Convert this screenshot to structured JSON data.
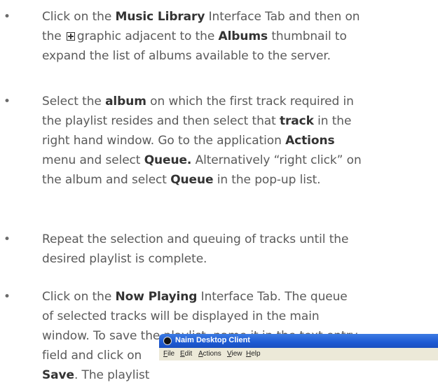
{
  "items": [
    {
      "bullet": "•",
      "lines": [
        [
          {
            "t": "Click on the "
          },
          {
            "t": "Music Library",
            "b": true
          },
          {
            "t": " Interface Tab and then on"
          }
        ],
        [
          {
            "t": "the "
          },
          {
            "icon": "expand"
          },
          {
            "t": "graphic adjacent to the "
          },
          {
            "t": "Albums",
            "b": true
          },
          {
            "t": " thumbnail to"
          }
        ],
        [
          {
            "t": "expand the list of albums available to the server."
          }
        ]
      ]
    },
    {
      "bullet": "•",
      "lines": [
        [
          {
            "t": "Select the "
          },
          {
            "t": "album",
            "b": true
          },
          {
            "t": " on which the first track required in"
          }
        ],
        [
          {
            "t": "the playlist resides and then select that "
          },
          {
            "t": "track",
            "b": true
          },
          {
            "t": " in the"
          }
        ],
        [
          {
            "t": "right hand window. Go to the application "
          },
          {
            "t": "Actions",
            "b": true
          }
        ],
        [
          {
            "t": "menu and select "
          },
          {
            "t": "Queue.",
            "b": true
          },
          {
            "t": " Alternatively “right click” on"
          }
        ],
        [
          {
            "t": "the album and select "
          },
          {
            "t": "Queue",
            "b": true
          },
          {
            "t": " in the pop-up list."
          }
        ]
      ]
    },
    {
      "bullet": "•",
      "lines": [
        [
          {
            "t": "Repeat the selection and queuing of tracks until the"
          }
        ],
        [
          {
            "t": "desired playlist is complete."
          }
        ]
      ]
    },
    {
      "bullet": "•",
      "lines": [
        [
          {
            "t": "Click on the "
          },
          {
            "t": "Now Playing",
            "b": true
          },
          {
            "t": " Interface Tab. The queue"
          }
        ],
        [
          {
            "t": "of selected tracks will be displayed in the main"
          }
        ],
        [
          {
            "t": "window. To save the playlist, name it in the text entry"
          }
        ],
        [
          {
            "t": "field and click on"
          }
        ],
        [
          {
            "t": "Save",
            "b": true
          },
          {
            "t": ". The playlist"
          }
        ]
      ]
    }
  ],
  "app_window": {
    "title": "Naim Desktop Client",
    "menu": [
      "File",
      "Edit",
      "Actions",
      "View",
      "Help"
    ]
  }
}
